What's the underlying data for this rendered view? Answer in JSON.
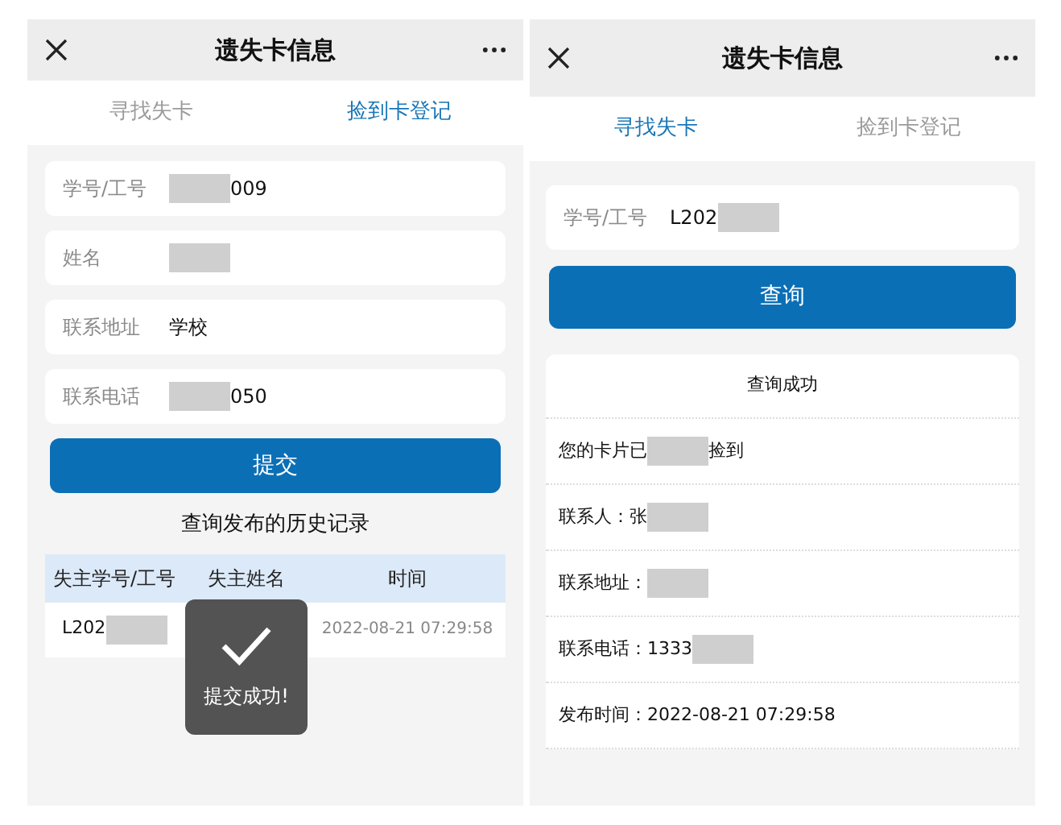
{
  "register_screen": {
    "title": "遗失卡信息",
    "tabs": [
      {
        "label": "寻找失卡",
        "selected": false
      },
      {
        "label": "捡到卡登记",
        "selected": true
      }
    ],
    "fields": [
      {
        "label": "学号/工号",
        "parts": [
          {
            "kind": "redacted"
          },
          {
            "kind": "text",
            "text": "009"
          }
        ]
      },
      {
        "label": "姓名",
        "parts": [
          {
            "kind": "redacted"
          }
        ]
      },
      {
        "label": "联系地址",
        "parts": [
          {
            "kind": "text",
            "text": "学校"
          }
        ]
      },
      {
        "label": "联系电话",
        "parts": [
          {
            "kind": "redacted"
          },
          {
            "kind": "text",
            "text": "050"
          }
        ]
      }
    ],
    "submit": "提交",
    "history_title": "查询发布的历史记录",
    "table": {
      "columns": [
        "失主学号/工号",
        "失主姓名",
        "时间"
      ],
      "rows": [
        {
          "cells": [
            [
              {
                "kind": "text",
                "text": "L202"
              },
              {
                "kind": "redacted"
              }
            ],
            [],
            [
              {
                "kind": "text",
                "text": "2022-08-21 07:29:58"
              }
            ]
          ]
        }
      ]
    },
    "toast": {
      "text": "提交成功!"
    }
  },
  "search_screen": {
    "title": "遗失卡信息",
    "tabs": [
      {
        "label": "寻找失卡",
        "selected": true
      },
      {
        "label": "捡到卡登记",
        "selected": false
      }
    ],
    "field": {
      "label": "学号/工号",
      "parts": [
        {
          "kind": "text",
          "text": "L202"
        },
        {
          "kind": "redacted"
        }
      ]
    },
    "query": "查询",
    "result_title": "查询成功",
    "results": [
      {
        "parts": [
          {
            "kind": "text",
            "text": "您的卡片已"
          },
          {
            "kind": "redacted"
          },
          {
            "kind": "text",
            "text": "捡到"
          }
        ]
      },
      {
        "parts": [
          {
            "kind": "text",
            "text": "联系人：张"
          },
          {
            "kind": "redacted"
          }
        ]
      },
      {
        "parts": [
          {
            "kind": "text",
            "text": "联系地址："
          },
          {
            "kind": "redacted"
          }
        ]
      },
      {
        "parts": [
          {
            "kind": "text",
            "text": "联系电话：1333"
          },
          {
            "kind": "redacted"
          }
        ]
      },
      {
        "parts": [
          {
            "kind": "text",
            "text": "发布时间：2022-08-21 07:29:58"
          }
        ]
      }
    ]
  }
}
